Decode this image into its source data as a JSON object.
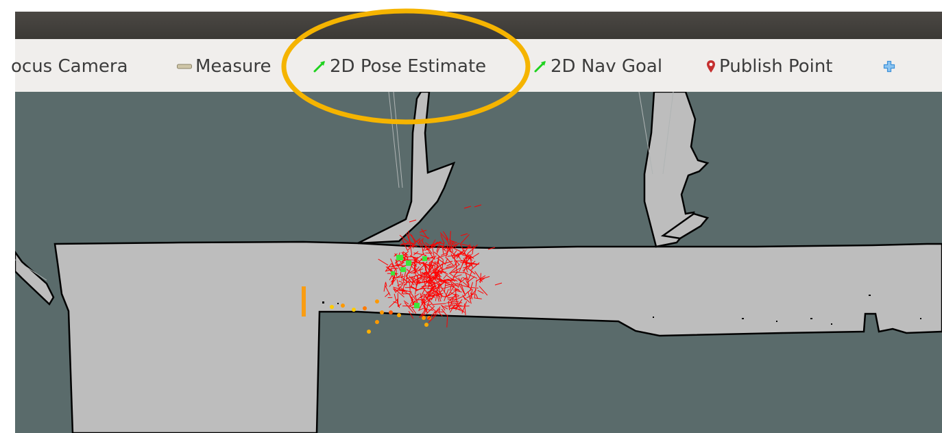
{
  "toolbar": {
    "tools": [
      {
        "label": "ocus Camera",
        "icon": "focus-camera-icon"
      },
      {
        "label": "Measure",
        "icon": "ruler-icon"
      },
      {
        "label": "2D Pose Estimate",
        "icon": "green-arrow-icon"
      },
      {
        "label": "2D Nav Goal",
        "icon": "green-arrow-icon"
      },
      {
        "label": "Publish Point",
        "icon": "map-pin-icon"
      },
      {
        "label": "",
        "icon": "plus-icon"
      }
    ]
  },
  "colors": {
    "titlebar": "#3f3d39",
    "toolbar": "#f0eeec",
    "map_unknown": "#5a6b6b",
    "map_free": "#bdbdbd",
    "map_occupied": "#000000",
    "arrow_icon": "#1fd21f",
    "pin_icon": "#c53030",
    "plus_icon": "#3a8fd8",
    "particles": "#ff0000",
    "laser_warm": "#ff9900",
    "highlight": "#f5b400"
  }
}
